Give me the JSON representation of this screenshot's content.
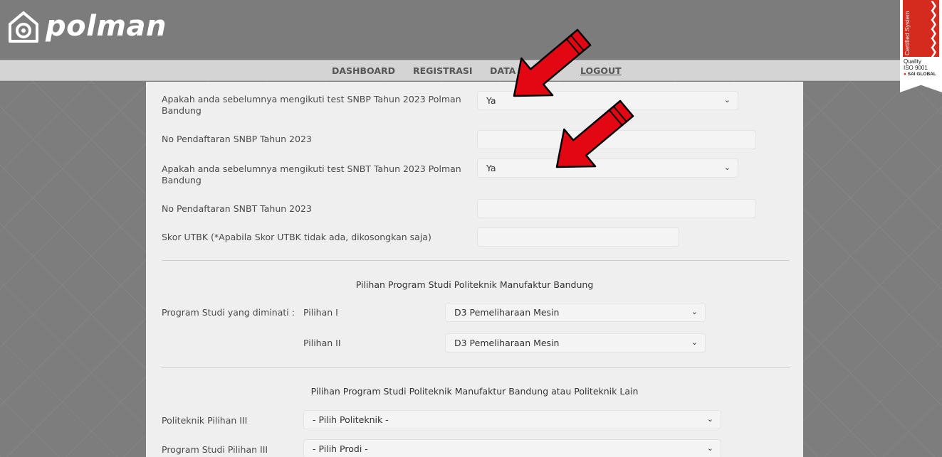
{
  "brand": {
    "name": "polman",
    "icon": "polman-logo-icon"
  },
  "nav": {
    "items": [
      {
        "label": "DASHBOARD"
      },
      {
        "label": "REGISTRASI"
      },
      {
        "label": "DATA"
      },
      {
        "label": "LOGOUT"
      }
    ]
  },
  "badge": {
    "vertical_text": "Certified System",
    "quality": "Quality",
    "iso": "ISO 9001",
    "sai": "SAI GLOBAL"
  },
  "form": {
    "snbp_question": "Apakah anda sebelumnya mengikuti test SNBP Tahun 2023 Polman Bandung",
    "snbp_answer": "Ya",
    "snbp_number_label": "No Pendaftaran SNBP Tahun 2023",
    "snbp_number_value": "",
    "snbt_question": "Apakah anda sebelumnya mengikuti test SNBT Tahun 2023 Polman Bandung",
    "snbt_answer": "Ya",
    "snbt_number_label": "No Pendaftaran SNBT Tahun 2023",
    "snbt_number_value": "",
    "utbk_label": "Skor UTBK (*Apabila Skor UTBK tidak ada, dikosongkan saja)",
    "utbk_value": ""
  },
  "section1": {
    "title": "Pilihan Program Studi Politeknik Manufaktur Bandung",
    "program_label": "Program Studi yang diminati :",
    "choice1_label": "Pilihan I",
    "choice1_value": "D3 Pemeliharaan Mesin",
    "choice2_label": "Pilihan II",
    "choice2_value": "D3 Pemeliharaan Mesin"
  },
  "section2": {
    "title": "Pilihan Program Studi Politeknik Manufaktur Bandung atau Politeknik Lain",
    "poltek_label": "Politeknik Pilihan III",
    "poltek_value": "- Pilih Politeknik -",
    "prodi_label": "Program Studi Pilihan III",
    "prodi_value": "- Pilih Prodi -"
  },
  "colors": {
    "accent_arrow": "#e30613",
    "header_bg": "#7c7c7c",
    "nav_bg": "#d4d4d4",
    "panel_bg": "#efefef"
  },
  "icons": {
    "dropdown": "chevron-down-icon",
    "annotation": "red-arrow-icon"
  }
}
